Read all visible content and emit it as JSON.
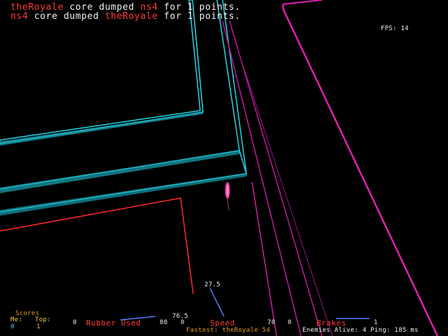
{
  "message_log": [
    {
      "killer": "theRoyale",
      "verb": " core dumped ",
      "victim": "ns4",
      "points": " for 1 points."
    },
    {
      "killer": "ns4",
      "verb": " core dumped ",
      "victim": "theRoyale",
      "points": " for 1 points."
    }
  ],
  "fps": {
    "label": "FPS:",
    "value": "14"
  },
  "scores": {
    "title": "Scores",
    "me_label": "Me:",
    "top_label": "Top:",
    "me_value": "0",
    "top_value": "1"
  },
  "rubber": {
    "label": "Rubber Used",
    "min": "0",
    "max": "80",
    "value": "76.5",
    "fraction": 0.96
  },
  "speed": {
    "label": "Speed",
    "min": "0",
    "max": "70",
    "value": "27.5",
    "fraction": 0.39
  },
  "brakes": {
    "label": "Brakes",
    "min": "0",
    "max": "1",
    "fraction": 1.0
  },
  "fastest": {
    "label": "Fastest:",
    "value": "theRoyale 54"
  },
  "status": {
    "enemies_label": "Enemies Alive:",
    "enemies_value": "4",
    "ping_label": "Ping:",
    "ping_value": "185 ms"
  },
  "colors": {
    "background": "#000000",
    "cyan_wall": "#23d6e6",
    "magenta_wall": "#e020b0",
    "red_wall": "#ff2a2a",
    "player_cycle": "#e040a0",
    "hud_red": "#ff3a3a",
    "hud_gold": "#e0a020",
    "hud_cyan": "#3fd8ff"
  }
}
